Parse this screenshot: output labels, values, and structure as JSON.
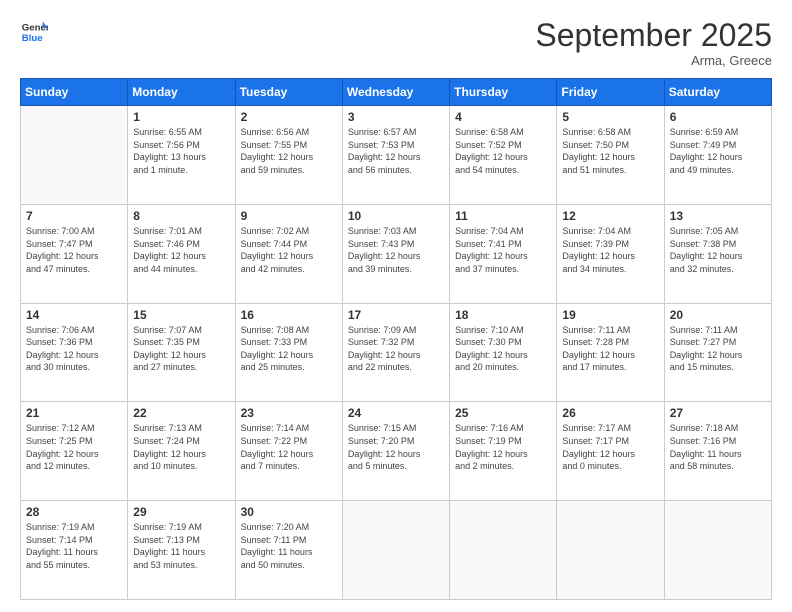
{
  "logo": {
    "line1": "General",
    "line2": "Blue"
  },
  "title": "September 2025",
  "location": "Arma, Greece",
  "days_of_week": [
    "Sunday",
    "Monday",
    "Tuesday",
    "Wednesday",
    "Thursday",
    "Friday",
    "Saturday"
  ],
  "weeks": [
    [
      {
        "day": "",
        "info": ""
      },
      {
        "day": "1",
        "info": "Sunrise: 6:55 AM\nSunset: 7:56 PM\nDaylight: 13 hours\nand 1 minute."
      },
      {
        "day": "2",
        "info": "Sunrise: 6:56 AM\nSunset: 7:55 PM\nDaylight: 12 hours\nand 59 minutes."
      },
      {
        "day": "3",
        "info": "Sunrise: 6:57 AM\nSunset: 7:53 PM\nDaylight: 12 hours\nand 56 minutes."
      },
      {
        "day": "4",
        "info": "Sunrise: 6:58 AM\nSunset: 7:52 PM\nDaylight: 12 hours\nand 54 minutes."
      },
      {
        "day": "5",
        "info": "Sunrise: 6:58 AM\nSunset: 7:50 PM\nDaylight: 12 hours\nand 51 minutes."
      },
      {
        "day": "6",
        "info": "Sunrise: 6:59 AM\nSunset: 7:49 PM\nDaylight: 12 hours\nand 49 minutes."
      }
    ],
    [
      {
        "day": "7",
        "info": "Sunrise: 7:00 AM\nSunset: 7:47 PM\nDaylight: 12 hours\nand 47 minutes."
      },
      {
        "day": "8",
        "info": "Sunrise: 7:01 AM\nSunset: 7:46 PM\nDaylight: 12 hours\nand 44 minutes."
      },
      {
        "day": "9",
        "info": "Sunrise: 7:02 AM\nSunset: 7:44 PM\nDaylight: 12 hours\nand 42 minutes."
      },
      {
        "day": "10",
        "info": "Sunrise: 7:03 AM\nSunset: 7:43 PM\nDaylight: 12 hours\nand 39 minutes."
      },
      {
        "day": "11",
        "info": "Sunrise: 7:04 AM\nSunset: 7:41 PM\nDaylight: 12 hours\nand 37 minutes."
      },
      {
        "day": "12",
        "info": "Sunrise: 7:04 AM\nSunset: 7:39 PM\nDaylight: 12 hours\nand 34 minutes."
      },
      {
        "day": "13",
        "info": "Sunrise: 7:05 AM\nSunset: 7:38 PM\nDaylight: 12 hours\nand 32 minutes."
      }
    ],
    [
      {
        "day": "14",
        "info": "Sunrise: 7:06 AM\nSunset: 7:36 PM\nDaylight: 12 hours\nand 30 minutes."
      },
      {
        "day": "15",
        "info": "Sunrise: 7:07 AM\nSunset: 7:35 PM\nDaylight: 12 hours\nand 27 minutes."
      },
      {
        "day": "16",
        "info": "Sunrise: 7:08 AM\nSunset: 7:33 PM\nDaylight: 12 hours\nand 25 minutes."
      },
      {
        "day": "17",
        "info": "Sunrise: 7:09 AM\nSunset: 7:32 PM\nDaylight: 12 hours\nand 22 minutes."
      },
      {
        "day": "18",
        "info": "Sunrise: 7:10 AM\nSunset: 7:30 PM\nDaylight: 12 hours\nand 20 minutes."
      },
      {
        "day": "19",
        "info": "Sunrise: 7:11 AM\nSunset: 7:28 PM\nDaylight: 12 hours\nand 17 minutes."
      },
      {
        "day": "20",
        "info": "Sunrise: 7:11 AM\nSunset: 7:27 PM\nDaylight: 12 hours\nand 15 minutes."
      }
    ],
    [
      {
        "day": "21",
        "info": "Sunrise: 7:12 AM\nSunset: 7:25 PM\nDaylight: 12 hours\nand 12 minutes."
      },
      {
        "day": "22",
        "info": "Sunrise: 7:13 AM\nSunset: 7:24 PM\nDaylight: 12 hours\nand 10 minutes."
      },
      {
        "day": "23",
        "info": "Sunrise: 7:14 AM\nSunset: 7:22 PM\nDaylight: 12 hours\nand 7 minutes."
      },
      {
        "day": "24",
        "info": "Sunrise: 7:15 AM\nSunset: 7:20 PM\nDaylight: 12 hours\nand 5 minutes."
      },
      {
        "day": "25",
        "info": "Sunrise: 7:16 AM\nSunset: 7:19 PM\nDaylight: 12 hours\nand 2 minutes."
      },
      {
        "day": "26",
        "info": "Sunrise: 7:17 AM\nSunset: 7:17 PM\nDaylight: 12 hours\nand 0 minutes."
      },
      {
        "day": "27",
        "info": "Sunrise: 7:18 AM\nSunset: 7:16 PM\nDaylight: 11 hours\nand 58 minutes."
      }
    ],
    [
      {
        "day": "28",
        "info": "Sunrise: 7:19 AM\nSunset: 7:14 PM\nDaylight: 11 hours\nand 55 minutes."
      },
      {
        "day": "29",
        "info": "Sunrise: 7:19 AM\nSunset: 7:13 PM\nDaylight: 11 hours\nand 53 minutes."
      },
      {
        "day": "30",
        "info": "Sunrise: 7:20 AM\nSunset: 7:11 PM\nDaylight: 11 hours\nand 50 minutes."
      },
      {
        "day": "",
        "info": ""
      },
      {
        "day": "",
        "info": ""
      },
      {
        "day": "",
        "info": ""
      },
      {
        "day": "",
        "info": ""
      }
    ]
  ]
}
